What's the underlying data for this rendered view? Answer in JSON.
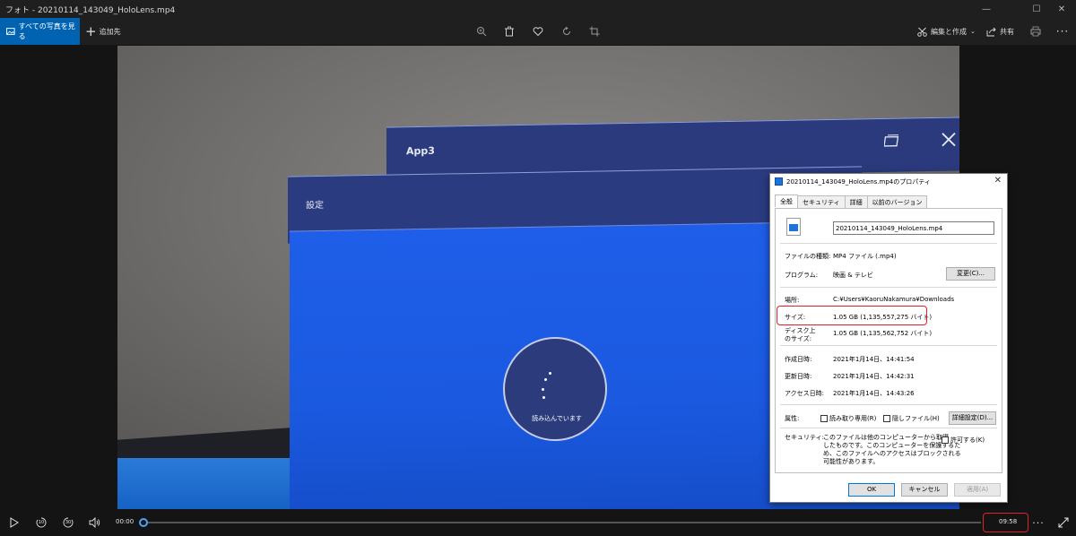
{
  "window": {
    "title": "フォト - 20210114_143049_HoloLens.mp4",
    "controls": {
      "minimize": "—",
      "maximize": "☐",
      "close": "✕"
    }
  },
  "toolbar": {
    "all_photos_label": "すべての写真を見る",
    "add_to_label": "追加先",
    "icons": [
      "zoom-icon",
      "trash-icon",
      "heart-icon",
      "rotate-icon",
      "crop-icon"
    ],
    "edit_create_label": "編集と作成",
    "share_label": "共有"
  },
  "video": {
    "app3_label": "App3",
    "settings_label": "設定",
    "loading_label": "読み込んでいます"
  },
  "dialog": {
    "title": "20210114_143049_HoloLens.mp4のプロパティ",
    "tabs": [
      "全般",
      "セキュリティ",
      "詳細",
      "以前のバージョン"
    ],
    "filename": "20210114_143049_HoloLens.mp4",
    "type_label": "ファイルの種類:",
    "type_value": "MP4 ファイル (.mp4)",
    "program_label": "プログラム:",
    "program_value": "映画 & テレビ",
    "change_button": "変更(C)...",
    "location_label": "場所:",
    "location_value": "C:¥Users¥KaoruNakamura¥Downloads",
    "size_label": "サイズ:",
    "size_value": "1.05 GB (1,135,557,275 バイト)",
    "disk_size_label_1": "ディスク上",
    "disk_size_label_2": "のサイズ:",
    "disk_size_value": "1.05 GB (1,135,562,752 バイト)",
    "created_label": "作成日時:",
    "created_value": "2021年1月14日、14:41:54",
    "modified_label": "更新日時:",
    "modified_value": "2021年1月14日、14:42:31",
    "accessed_label": "アクセス日時:",
    "accessed_value": "2021年1月14日、14:43:26",
    "attributes_label": "属性:",
    "readonly_label": "読み取り専用(R)",
    "hidden_label": "隠しファイル(H)",
    "advanced_button": "詳細設定(D)...",
    "security_label": "セキュリティ:",
    "security_text_1": "このファイルは他のコンピューターから取得",
    "security_text_2": "したものです。このコンピューターを保護するた",
    "security_text_3": "め、このファイルへのアクセスはブロックされる",
    "security_text_4": "可能性があります。",
    "allow_label": "許可する(K)",
    "ok_button": "OK",
    "cancel_button": "キャンセル",
    "apply_button": "適用(A)"
  },
  "playback": {
    "current_time": "00:00",
    "total_time": "09:58",
    "skip_back_label": "10",
    "skip_forward_label": "30",
    "progress_fraction": 0.0
  },
  "colors": {
    "accent": "#0063b1",
    "highlight_box": "#e0202a"
  }
}
